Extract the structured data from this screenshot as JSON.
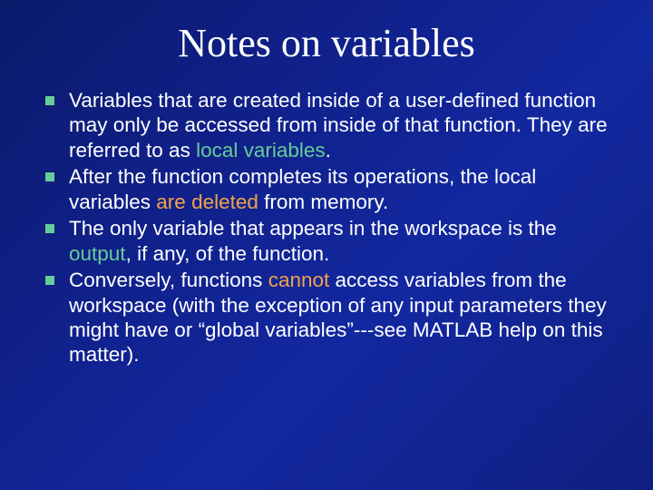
{
  "title": "Notes on variables",
  "bullets": [
    {
      "pre1": "Variables that are created inside of a user-defined function may only be accessed from inside of that function. They are referred to as ",
      "h1": "local variables",
      "post1": "."
    },
    {
      "pre1": "After the function completes its operations, the local variables ",
      "h1": "are deleted",
      "post1": " from memory."
    },
    {
      "pre1": "The only variable that appears in the workspace is the ",
      "h1": "output",
      "post1": ", if any, of the function."
    },
    {
      "pre1": "Conversely, functions ",
      "h1": "cannot",
      "post1": " access variables from the workspace (with the exception of any input parameters they might have or “global variables”---see MATLAB help on this matter)."
    }
  ],
  "highlight_class": [
    "hl-green",
    "hl-orange",
    "hl-green",
    "hl-orange"
  ]
}
